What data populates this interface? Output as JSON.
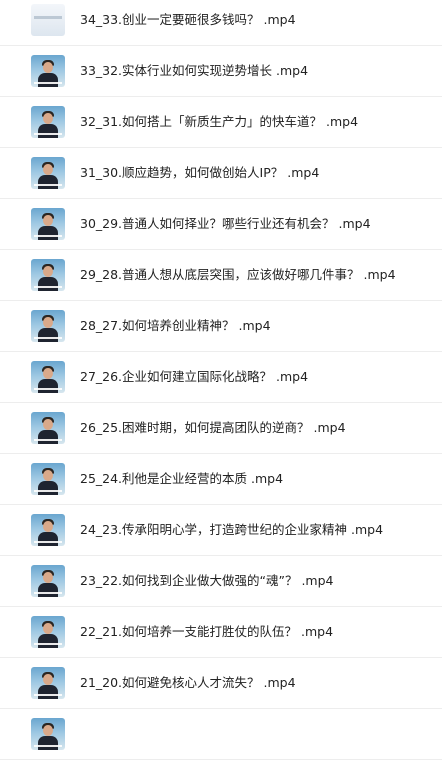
{
  "video_list": {
    "items": [
      {
        "title": "34_33.创业一定要砸很多钱吗？ .mp4",
        "thumbnail": "slide-thumbnail"
      },
      {
        "title": "33_32.实体行业如何实现逆势增长 .mp4",
        "thumbnail": "speaker-thumbnail"
      },
      {
        "title": "32_31.如何搭上「新质生产力」的快车道？ .mp4",
        "thumbnail": "speaker-thumbnail"
      },
      {
        "title": "31_30.顺应趋势，如何做创始人IP？ .mp4",
        "thumbnail": "speaker-thumbnail"
      },
      {
        "title": "30_29.普通人如何择业？哪些行业还有机会？ .mp4",
        "thumbnail": "speaker-thumbnail"
      },
      {
        "title": "29_28.普通人想从底层突围，应该做好哪几件事？ .mp4",
        "thumbnail": "speaker-thumbnail"
      },
      {
        "title": "28_27.如何培养创业精神？ .mp4",
        "thumbnail": "speaker-thumbnail"
      },
      {
        "title": "27_26.企业如何建立国际化战略？ .mp4",
        "thumbnail": "speaker-thumbnail"
      },
      {
        "title": "26_25.困难时期，如何提高团队的逆商？ .mp4",
        "thumbnail": "speaker-thumbnail"
      },
      {
        "title": "25_24.利他是企业经营的本质 .mp4",
        "thumbnail": "speaker-thumbnail"
      },
      {
        "title": "24_23.传承阳明心学，打造跨世纪的企业家精神 .mp4",
        "thumbnail": "speaker-thumbnail"
      },
      {
        "title": "23_22.如何找到企业做大做强的“魂”？ .mp4",
        "thumbnail": "speaker-thumbnail"
      },
      {
        "title": "22_21.如何培养一支能打胜仗的队伍？ .mp4",
        "thumbnail": "speaker-thumbnail"
      },
      {
        "title": "21_20.如何避免核心人才流失？ .mp4",
        "thumbnail": "speaker-thumbnail"
      }
    ]
  }
}
